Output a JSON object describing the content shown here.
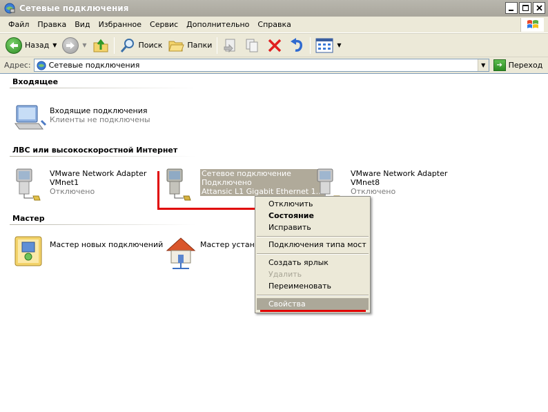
{
  "window": {
    "title": "Сетевые подключения"
  },
  "menu": [
    {
      "label": "Файл"
    },
    {
      "label": "Правка"
    },
    {
      "label": "Вид"
    },
    {
      "label": "Избранное"
    },
    {
      "label": "Сервис"
    },
    {
      "label": "Дополнительно"
    },
    {
      "label": "Справка"
    }
  ],
  "toolbar": {
    "back_label": "Назад",
    "search_label": "Поиск",
    "folders_label": "Папки"
  },
  "address": {
    "label": "Адрес:",
    "value": "Сетевые подключения",
    "go_label": "Переход"
  },
  "groups": {
    "incoming": {
      "header": "Входящее",
      "item": {
        "title": "Входящие подключения",
        "subtitle": "Клиенты не подключены"
      }
    },
    "lan": {
      "header": "ЛВС или высокоскоростной Интернет",
      "items": [
        {
          "title": "VMware Network Adapter",
          "line2": "VMnet1",
          "status": "Отключено"
        },
        {
          "title": "Сетевое подключение",
          "line2": "Подключено",
          "status": "Attansic L1 Gigabit Ethernet 1..."
        },
        {
          "title": "VMware Network Adapter",
          "line2": "VMnet8",
          "status": "Отключено"
        }
      ]
    },
    "wizard": {
      "header": "Мастер",
      "items": [
        {
          "title": "Мастер новых подключений"
        },
        {
          "title": "Мастер установ"
        }
      ]
    }
  },
  "context_menu": {
    "items": [
      {
        "label": "Отключить"
      },
      {
        "label": "Состояние"
      },
      {
        "label": "Исправить"
      },
      {
        "label": "Подключения типа мост"
      },
      {
        "label": "Создать ярлык"
      },
      {
        "label": "Удалить"
      },
      {
        "label": "Переименовать"
      },
      {
        "label": "Свойства"
      }
    ]
  },
  "colors": {
    "highlight": "#aca899",
    "annotation_red": "#e00000",
    "chrome": "#ece9d8"
  }
}
